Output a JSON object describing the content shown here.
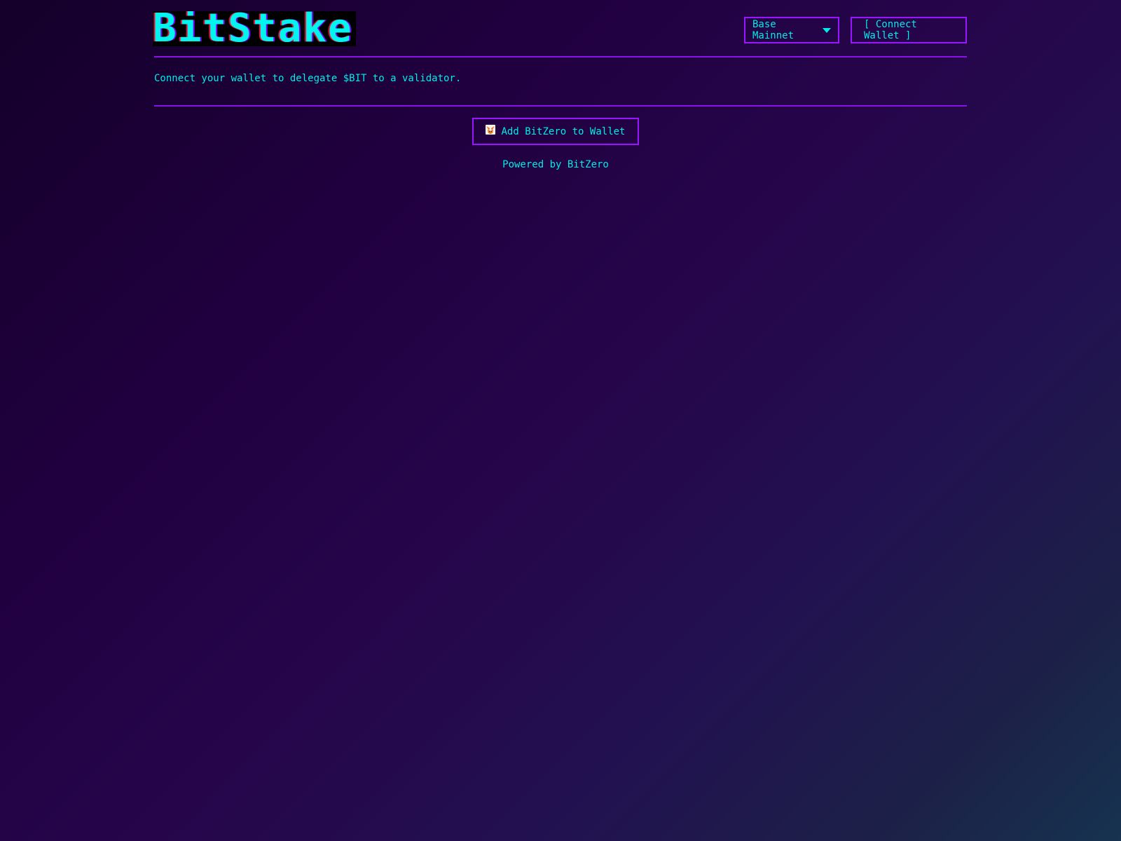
{
  "header": {
    "logo_text": "BitStake",
    "network_label": "Base Mainnet",
    "connect_label": "[ Connect Wallet ]"
  },
  "main": {
    "info_text": "Connect your wallet to delegate $BIT to a validator.",
    "add_button_label": "Add BitZero to Wallet",
    "add_button_icon": "metamask-fox-icon",
    "powered_by": "Powered by BitZero"
  },
  "colors": {
    "accent": "#9b14ff",
    "text": "#00ece6",
    "background": "#210040"
  }
}
